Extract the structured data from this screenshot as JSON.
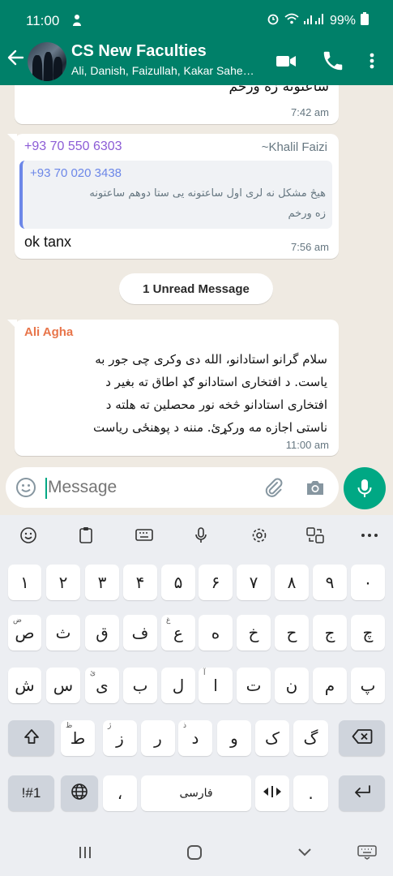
{
  "status_bar": {
    "time": "11:00",
    "battery": "99%"
  },
  "header": {
    "title": "CS New Faculties",
    "subtitle": "Ali, Danish, Faizullah, Kakar Sahe…"
  },
  "messages": [
    {
      "text": "ساعتونه زه ورخم",
      "time": "7:42 am"
    },
    {
      "sender_phone": "+93 70 550 6303",
      "sender_name": "~Khalil Faizi",
      "quote_phone": "+93 70 020 3438",
      "quote_line1": "هیڅ مشکل نه لری اول ساعتونه یی ستا دوهم ساعتونه",
      "quote_line2": "زه ورخم",
      "text": "ok tanx",
      "time": "7:56 am"
    },
    {
      "sender_name": "Ali Agha",
      "lines": [
        "سلام گرانو استادانو، الله دی وکری چی جور به",
        "یاست. د افتخاری استادانو ګډ  اطاق ته بغیر د",
        "افتخاری استادانو څخه نور محصلین ته هلته د",
        "ناستی اجازه مه ورکړئ. مننه د پوهنځی ریاست"
      ],
      "time": "11:00 am"
    }
  ],
  "unread_label": "1 Unread Message",
  "composer": {
    "placeholder": "Message"
  },
  "keyboard": {
    "row1": [
      "۱",
      "۲",
      "۳",
      "۴",
      "۵",
      "۶",
      "۷",
      "۸",
      "۹",
      "۰"
    ],
    "row2": [
      "ص",
      "ث",
      "ق",
      "ف",
      "ع",
      "ه",
      "خ",
      "ح",
      "ج",
      "چ"
    ],
    "row2_hints": [
      "ض",
      "",
      "",
      "",
      "غ",
      "",
      "",
      "",
      "",
      ""
    ],
    "row3": [
      "ش",
      "س",
      "ی",
      "ب",
      "ل",
      "ا",
      "ت",
      "ن",
      "م",
      "پ"
    ],
    "row3_hints": [
      "",
      "",
      "ئ",
      "",
      "",
      "آ",
      "",
      "",
      "",
      ""
    ],
    "row4": [
      "ط",
      "ز",
      "ر",
      "د",
      "و",
      "ک",
      "گ"
    ],
    "row4_hints": [
      "ظ",
      "ژ",
      "",
      "ذ",
      "",
      "",
      ""
    ],
    "symbols_label": "!#1",
    "comma": "،",
    "space_label": "فارسی",
    "period": "."
  },
  "colors": {
    "header": "#008069",
    "accent": "#00a884",
    "chat_bg": "#efeae2"
  }
}
